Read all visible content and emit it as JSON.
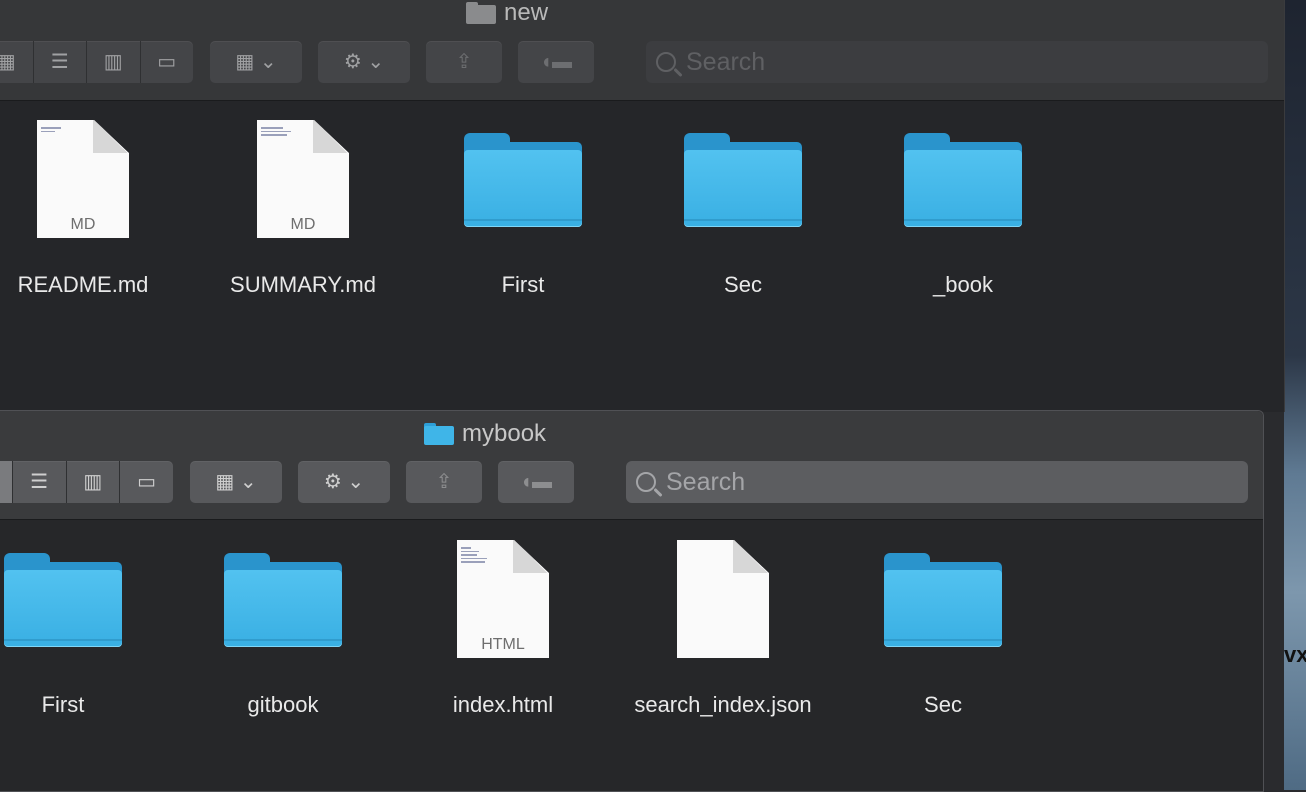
{
  "window_back": {
    "title": "new",
    "search_placeholder": "Search",
    "items": [
      {
        "name": "README.md",
        "type": "doc",
        "ext": "MD"
      },
      {
        "name": "SUMMARY.md",
        "type": "doc",
        "ext": "MD"
      },
      {
        "name": "First",
        "type": "folder"
      },
      {
        "name": "Sec",
        "type": "folder"
      },
      {
        "name": "_book",
        "type": "folder"
      }
    ]
  },
  "window_front": {
    "title": "mybook",
    "search_placeholder": "Search",
    "items": [
      {
        "name": "First",
        "type": "folder"
      },
      {
        "name": "gitbook",
        "type": "folder"
      },
      {
        "name": "index.html",
        "type": "doc",
        "ext": "HTML"
      },
      {
        "name": "search_index.json",
        "type": "doc",
        "ext": ""
      },
      {
        "name": "Sec",
        "type": "folder"
      }
    ]
  },
  "desktop": {
    "text": "vx"
  },
  "colors": {
    "folder": "#3fb5e8",
    "window_bg": "#252629",
    "toolbar": "#363739"
  }
}
